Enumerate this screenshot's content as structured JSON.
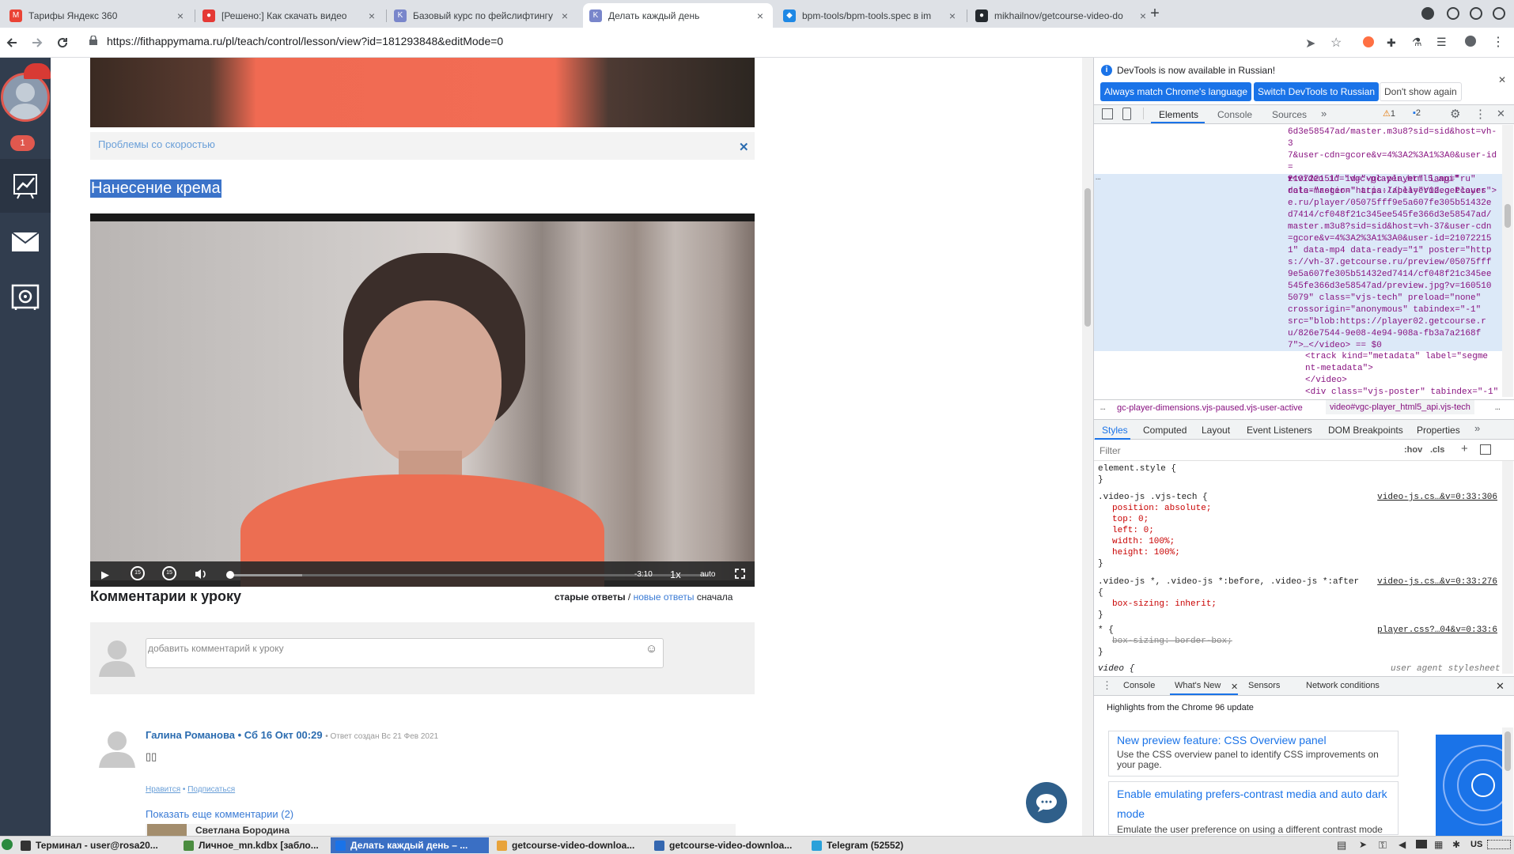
{
  "tabs": [
    {
      "title": "Тарифы Яндекс 360",
      "fav": "M",
      "color": "#ea4335"
    },
    {
      "title": "[Решено:] Как скачать видео",
      "fav": "●",
      "color": "#e53935"
    },
    {
      "title": "Базовый курс по фейслифтингу",
      "fav": "K",
      "color": "#7986cb"
    },
    {
      "title": "Делать каждый день",
      "fav": "K",
      "color": "#7986cb"
    },
    {
      "title": "bpm-tools/bpm-tools.spec в im",
      "fav": "◆",
      "color": "#1e88e5"
    },
    {
      "title": "mikhailnov/getcourse-video-do",
      "fav": "●",
      "color": "#24292e"
    }
  ],
  "new_tab": "+",
  "url": "https://fithappymama.ru/pl/teach/control/lesson/view?id=181293848&editMode=0",
  "sidebar": {
    "badge": "1",
    "icons": [
      "chart-icon",
      "mail-icon",
      "safe-icon"
    ]
  },
  "page": {
    "speed_problems": "Проблемы со скоростью",
    "lesson_title": "Нанесение крема",
    "video": {
      "time": "-3:10",
      "speed": "1x",
      "quality": "auto"
    },
    "comments_heading": "Комментарии к уроку",
    "sort": {
      "old": "старые ответы",
      "sep": "/",
      "new": "новые ответы",
      "suffix": "сначала"
    },
    "comment_placeholder": "добавить комментарий к уроку",
    "comment": {
      "author": "Галина Романова",
      "date": "Сб 16 Окт 00:29",
      "created": "• Ответ создан Вс 21 Фев 2021",
      "body": "▯▯",
      "like": "Нравится",
      "dot": "•",
      "subscribe": "Подписаться",
      "more": "Показать еще комментарии (2)",
      "next_author": "Светлана Бородина"
    }
  },
  "devtools": {
    "banner": "DevTools is now available in Russian!",
    "btn_match": "Always match Chrome's language",
    "btn_switch": "Switch DevTools to Russian",
    "btn_dont": "Don't show again",
    "tabs": [
      "Elements",
      "Console",
      "Sources"
    ],
    "warn": "1",
    "msg": "2",
    "code_top": [
      "6d3e58547ad/master.m3u8?sid=sid&host=vh-3",
      "7&user-cdn=gcore&v=4%3A2%3A1%3A0&user-id=",
      "210722151\" id=\"vgc-player\" lang=\"ru\"",
      "role=\"region\" aria-label=\"Video Player\">"
    ],
    "code_sel": [
      "▾<video id=\"vgc-player_html5_api\"",
      "data-master=\"https://player02.getcours",
      "e.ru/player/05075fff9e5a607fe305b51432e",
      "d7414/cf048f21c345ee545fe366d3e58547ad/",
      "master.m3u8?sid=sid&host=vh-37&user-cdn",
      "=gcore&v=4%3A2%3A1%3A0&user-id=21072215",
      "1\" data-mp4 data-ready=\"1\" poster=\"http",
      "s://vh-37.getcourse.ru/preview/05075fff",
      "9e5a607fe305b51432ed7414/cf048f21c345ee",
      "545fe366d3e58547ad/preview.jpg?v=160510",
      "5079\" class=\"vjs-tech\" preload=\"none\"",
      "crossorigin=\"anonymous\" tabindex=\"-1\"",
      "src=\"blob:https://player02.getcourse.r",
      "u/826e7544-9e08-4e94-908a-fb3a7a2168f",
      "7\">…</video> == $0"
    ],
    "code_after": [
      "<track kind=\"metadata\" label=\"segme",
      "nt-metadata\">",
      "</video>",
      "<div class=\"vjs-poster\" tabindex=\"-1\""
    ],
    "breadcrumb1": "gc-player-dimensions.vjs-paused.vjs-user-active",
    "breadcrumb2": "video#vgc-player_html5_api.vjs-tech",
    "styles_tabs": [
      "Styles",
      "Computed",
      "Layout",
      "Event Listeners",
      "DOM Breakpoints",
      "Properties"
    ],
    "filter": "Filter",
    "hov": ":hov",
    "cls": ".cls",
    "rules": [
      {
        "sel": "element.style {",
        "src": "",
        "props": [],
        "close": "}"
      },
      {
        "sel": ".video-js .vjs-tech {",
        "src": "video-js.cs…&v=0:33:306",
        "props": [
          "position: absolute;",
          "top: 0;",
          "left: 0;",
          "width: 100%;",
          "height: 100%;"
        ],
        "close": "}"
      },
      {
        "sel": ".video-js *, .video-js *:before, .video-js *:after",
        "src": "video-js.cs…&v=0:33:276",
        "props": [
          "{",
          "box-sizing: inherit;"
        ],
        "close": "}"
      },
      {
        "sel": "* {",
        "src": "player.css?…04&v=0:33:6",
        "props": [
          "box-sizing: border-box;"
        ],
        "close": "}"
      }
    ],
    "ua_sel": "video {",
    "ua_src": "user agent stylesheet",
    "drawer_tabs": [
      "Console",
      "What's New",
      "Sensors",
      "Network conditions"
    ],
    "highlights": "Highlights from the Chrome 96 update",
    "card1_title": "New preview feature: CSS Overview panel",
    "card1_body": "Use the CSS overview panel to identify CSS improvements on your page.",
    "card2_title": "Enable emulating prefers-contrast media and auto dark mode",
    "card2_body": "Emulate the user preference on using a different contrast mode for the page and Chrome's auto dark mode."
  },
  "taskbar": {
    "items": [
      "Терминал - user@rosa20...",
      "Личное_mn.kdbx [забло...",
      "Делать каждый день – ...",
      "getcourse-video-downloa...",
      "getcourse-video-downloa...",
      "Telegram (52552)"
    ],
    "lang": "US"
  }
}
